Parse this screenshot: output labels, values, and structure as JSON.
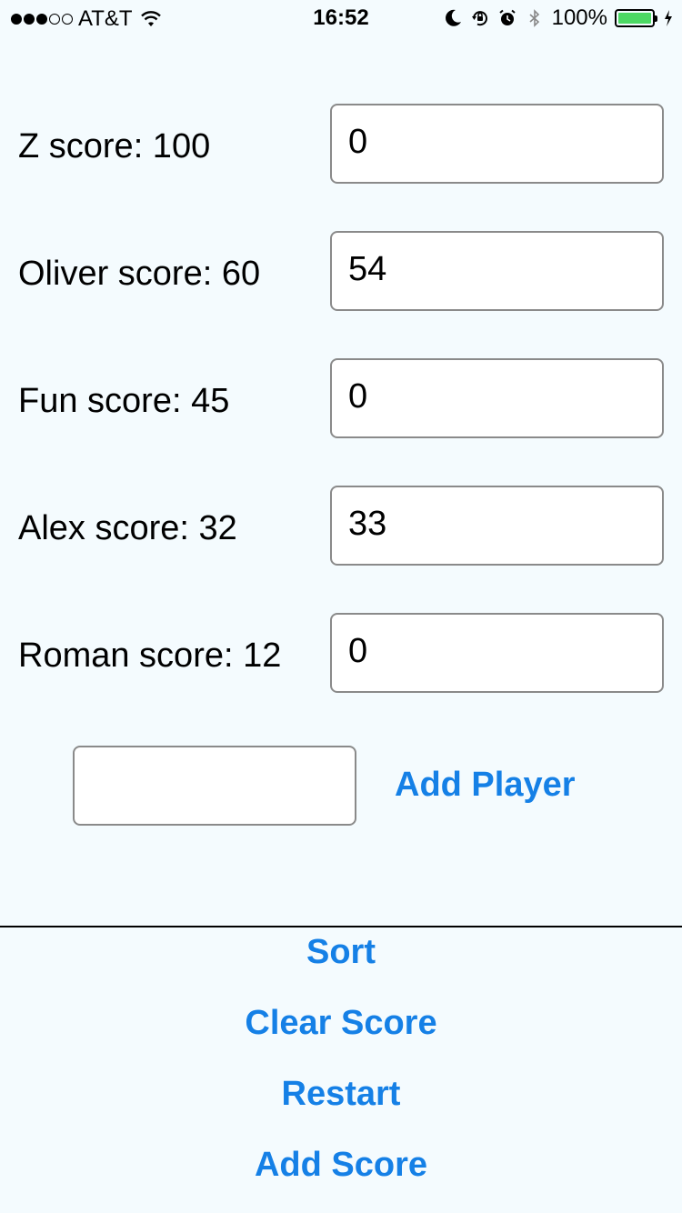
{
  "status_bar": {
    "carrier": "AT&T",
    "time": "16:52",
    "battery_percent": "100%",
    "battery_level": 1.0,
    "signal_bars_filled": 3,
    "signal_bars_total": 5,
    "icons": [
      "wifi-icon",
      "moon-icon",
      "rotation-lock-icon",
      "alarm-icon",
      "bluetooth-icon",
      "battery-icon",
      "charging-icon"
    ]
  },
  "players": [
    {
      "label": "Z score: 100",
      "input_value": "0"
    },
    {
      "label": "Oliver score: 60",
      "input_value": "54"
    },
    {
      "label": "Fun score: 45",
      "input_value": "0"
    },
    {
      "label": "Alex score: 32",
      "input_value": "33"
    },
    {
      "label": "Roman score: 12",
      "input_value": "0"
    }
  ],
  "add_player": {
    "input_value": "",
    "button_label": "Add Player"
  },
  "actions": {
    "sort": "Sort",
    "clear_score": "Clear Score",
    "restart": "Restart",
    "add_score": "Add Score"
  },
  "colors": {
    "background": "#f4fbfe",
    "accent": "#1580e6",
    "battery": "#4cd964"
  }
}
